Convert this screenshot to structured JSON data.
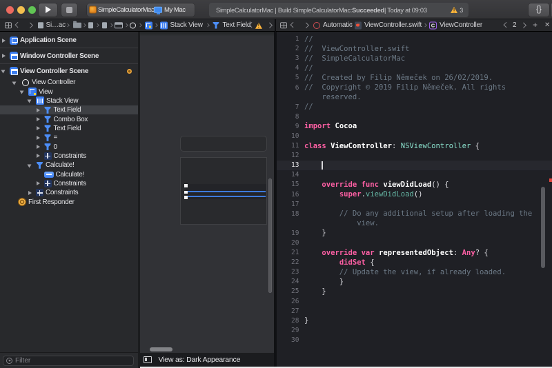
{
  "toolbar": {
    "scheme_project": "SimpleCalculatorMac",
    "scheme_device": "My Mac",
    "status_left": "SimpleCalculatorMac | Build SimpleCalculatorMac: ",
    "status_bold": "Succeeded",
    "status_right": " | Today at 09:03",
    "warning_count": "3",
    "braces_label": "{}"
  },
  "ib_jumpbar": {
    "doc": "Si…ac",
    "stack_view": "Stack View",
    "text_field": "Text Field"
  },
  "editor_jumpbar": {
    "automatic": "Automatic",
    "file": "ViewController.swift",
    "symbol": "ViewController",
    "counter": "2",
    "plus": "+",
    "close": "✕"
  },
  "outline": {
    "rows": [
      {
        "indent": 3,
        "disc": "closed",
        "icon": "appscene",
        "label": "Application Scene",
        "scene": true,
        "sepAfter": true
      },
      {
        "indent": 3,
        "disc": "closed",
        "icon": "winscene",
        "label": "Window Controller Scene",
        "scene": true,
        "sepAfter": true
      },
      {
        "indent": 3,
        "disc": "open",
        "icon": "winscene",
        "label": "View Controller Scene",
        "scene": true,
        "badge": true,
        "gapAfter": true
      },
      {
        "indent": 19,
        "disc": "open",
        "icon": "vc",
        "label": "View Controller"
      },
      {
        "indent": 30,
        "disc": "open",
        "icon": "view",
        "label": "View"
      },
      {
        "indent": 41,
        "disc": "open",
        "icon": "stack",
        "label": "Stack View"
      },
      {
        "indent": 52.5,
        "disc": "closed",
        "icon": "control",
        "label": "Text Field",
        "sel": true
      },
      {
        "indent": 52.5,
        "disc": "closed",
        "icon": "control",
        "label": "Combo Box"
      },
      {
        "indent": 52.5,
        "disc": "closed",
        "icon": "control",
        "label": "Text Field"
      },
      {
        "indent": 52.5,
        "disc": "closed",
        "icon": "control",
        "label": "="
      },
      {
        "indent": 52.5,
        "disc": "closed",
        "icon": "control",
        "label": "0"
      },
      {
        "indent": 52.5,
        "disc": "closed",
        "icon": "constraints",
        "label": "Constraints"
      },
      {
        "indent": 41,
        "disc": "open",
        "icon": "control",
        "label": "Calculate!"
      },
      {
        "indent": 52.5,
        "disc": "none",
        "icon": "button",
        "label": "Calculate!"
      },
      {
        "indent": 52.5,
        "disc": "closed",
        "icon": "constraints",
        "label": "Constraints"
      },
      {
        "indent": 41,
        "disc": "closed",
        "icon": "constraints",
        "label": "Constraints"
      },
      {
        "indent": 15,
        "disc": "none",
        "icon": "fr",
        "label": "First Responder"
      }
    ]
  },
  "filter": {
    "placeholder": "Filter"
  },
  "canvas": {
    "view_as": "View as: Dark Appearance"
  },
  "code": {
    "lines": [
      {
        "n": "1",
        "seg": [
          [
            "c",
            "//"
          ]
        ]
      },
      {
        "n": "2",
        "seg": [
          [
            "c",
            "//  ViewController.swift"
          ]
        ]
      },
      {
        "n": "3",
        "seg": [
          [
            "c",
            "//  SimpleCalculatorMac"
          ]
        ]
      },
      {
        "n": "4",
        "seg": [
          [
            "c",
            "//"
          ]
        ]
      },
      {
        "n": "5",
        "seg": [
          [
            "c",
            "//  Created by Filip Němeček on 26/02/2019."
          ]
        ]
      },
      {
        "n": "6",
        "seg": [
          [
            "c",
            "//  Copyright © 2019 Filip Němeček. All rights"
          ]
        ]
      },
      {
        "n": "",
        "seg": [
          [
            "c",
            "    reserved."
          ]
        ]
      },
      {
        "n": "7",
        "seg": [
          [
            "c",
            "//"
          ]
        ]
      },
      {
        "n": "8",
        "seg": []
      },
      {
        "n": "9",
        "seg": [
          [
            "k",
            "import"
          ],
          [
            "p",
            " "
          ],
          [
            "d",
            "Cocoa"
          ]
        ]
      },
      {
        "n": "10",
        "seg": []
      },
      {
        "n": "11",
        "seg": [
          [
            "k",
            "class"
          ],
          [
            "p",
            " "
          ],
          [
            "d",
            "ViewController"
          ],
          [
            "p",
            ": "
          ],
          [
            "t",
            "NSViewController"
          ],
          [
            "p",
            " {"
          ]
        ]
      },
      {
        "n": "12",
        "seg": []
      },
      {
        "n": "13",
        "seg": [],
        "cur": true
      },
      {
        "n": "14",
        "seg": []
      },
      {
        "n": "15",
        "seg": [
          [
            "p",
            "    "
          ],
          [
            "k",
            "override"
          ],
          [
            "p",
            " "
          ],
          [
            "k",
            "func"
          ],
          [
            "p",
            " "
          ],
          [
            "d",
            "viewDidLoad"
          ],
          [
            "p",
            "() {"
          ]
        ]
      },
      {
        "n": "16",
        "seg": [
          [
            "p",
            "        "
          ],
          [
            "k",
            "super"
          ],
          [
            "p",
            "."
          ],
          [
            "m",
            "viewDidLoad"
          ],
          [
            "p",
            "()"
          ]
        ]
      },
      {
        "n": "17",
        "seg": []
      },
      {
        "n": "18",
        "seg": [
          [
            "c",
            "        // Do any additional setup after loading the"
          ]
        ]
      },
      {
        "n": "",
        "seg": [
          [
            "c",
            "            view."
          ]
        ]
      },
      {
        "n": "19",
        "seg": [
          [
            "p",
            "    }"
          ]
        ]
      },
      {
        "n": "20",
        "seg": []
      },
      {
        "n": "21",
        "seg": [
          [
            "p",
            "    "
          ],
          [
            "k",
            "override"
          ],
          [
            "p",
            " "
          ],
          [
            "k",
            "var"
          ],
          [
            "p",
            " "
          ],
          [
            "d",
            "representedObject"
          ],
          [
            "p",
            ": "
          ],
          [
            "k",
            "Any"
          ],
          [
            "p",
            "? {"
          ]
        ]
      },
      {
        "n": "22",
        "seg": [
          [
            "p",
            "        "
          ],
          [
            "k",
            "didSet"
          ],
          [
            "p",
            " {"
          ]
        ]
      },
      {
        "n": "23",
        "seg": [
          [
            "c",
            "        // Update the view, if already loaded."
          ]
        ]
      },
      {
        "n": "24",
        "seg": [
          [
            "p",
            "        }"
          ]
        ]
      },
      {
        "n": "25",
        "seg": [
          [
            "p",
            "    }"
          ]
        ]
      },
      {
        "n": "26",
        "seg": []
      },
      {
        "n": "27",
        "seg": []
      },
      {
        "n": "28",
        "seg": [
          [
            "p",
            "}"
          ]
        ]
      },
      {
        "n": "29",
        "seg": []
      },
      {
        "n": "30",
        "seg": []
      }
    ]
  }
}
